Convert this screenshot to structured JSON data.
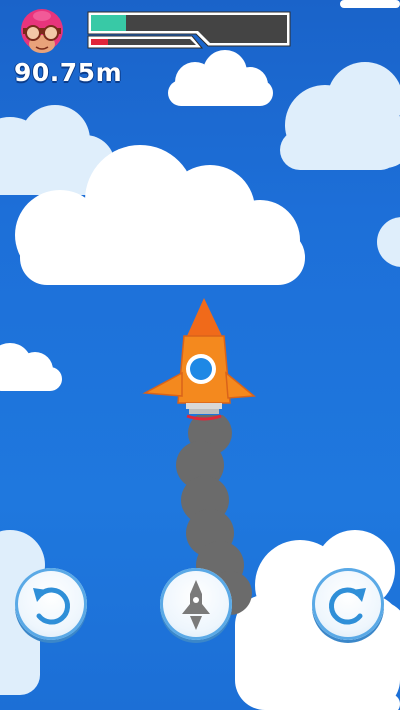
{
  "hud": {
    "distance": "90.75m",
    "fuel_level": 0.18,
    "health_level": 0.17,
    "colors": {
      "fuel": "#38c9a6",
      "health": "#e0263a",
      "bar_bg": "#444444"
    }
  },
  "player": {
    "avatar_icon": "pilot-goggles-avatar-icon",
    "rocket_color": "#f4891e",
    "nose_color": "#f06a1a",
    "window_color": "#1e88e5"
  },
  "controls": [
    {
      "name": "rotate-left-button",
      "icon": "rotate-left-icon"
    },
    {
      "name": "boost-button",
      "icon": "rocket-icon"
    },
    {
      "name": "rotate-right-button",
      "icon": "rotate-right-icon"
    }
  ]
}
